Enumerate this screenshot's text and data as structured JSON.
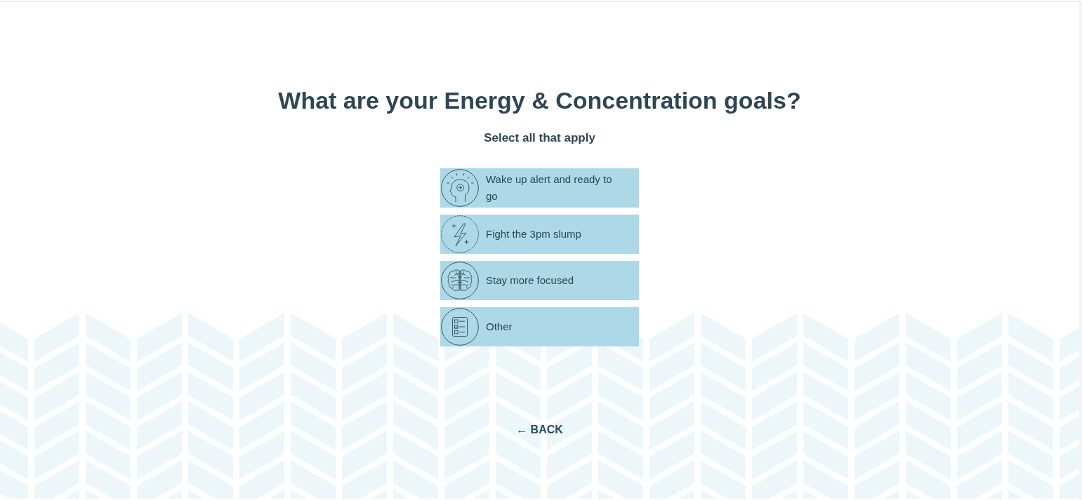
{
  "title": "What are your Energy & Concentration goals?",
  "subtitle": "Select all that apply",
  "options": [
    {
      "label": "Wake up alert and ready to go",
      "selected": false
    },
    {
      "label": "Fight the 3pm slump",
      "selected": false
    },
    {
      "label": "Stay more focused",
      "selected": false
    },
    {
      "label": "Other",
      "selected": false
    }
  ],
  "back_button": {
    "label": "← BACK"
  }
}
